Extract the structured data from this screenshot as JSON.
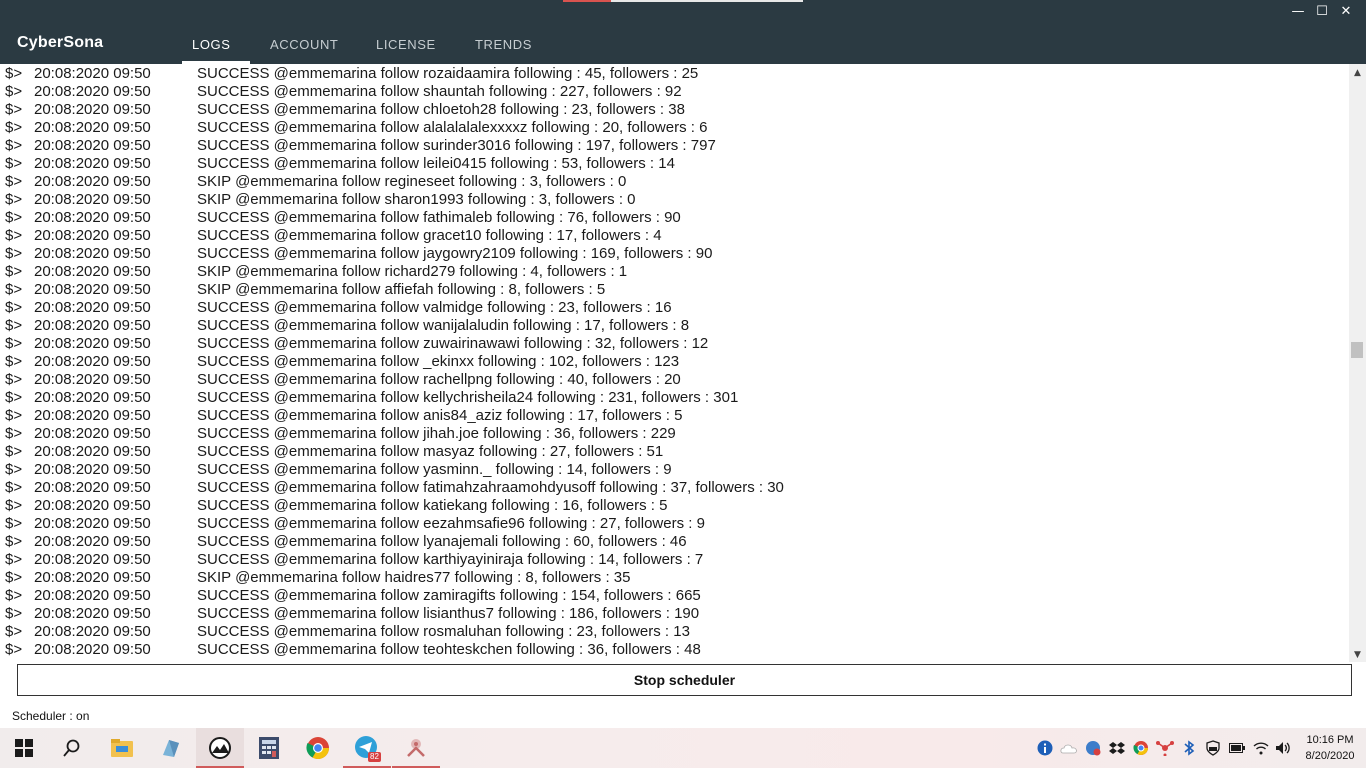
{
  "window": {
    "minimize": "—",
    "maximize": "☐",
    "close": "✕"
  },
  "app": {
    "title": "CyberSona"
  },
  "tabs": [
    {
      "label": "LOGS",
      "active": true
    },
    {
      "label": "ACCOUNT",
      "active": false
    },
    {
      "label": "LICENSE",
      "active": false
    },
    {
      "label": "TRENDS",
      "active": false
    }
  ],
  "logs": [
    {
      "prompt": "$>",
      "timestamp": "20:08:2020 09:50",
      "message": "SUCCESS @emmemarina follow rozaidaamira following : 45, followers : 25"
    },
    {
      "prompt": "$>",
      "timestamp": "20:08:2020 09:50",
      "message": "SUCCESS @emmemarina follow shauntah following : 227, followers : 92"
    },
    {
      "prompt": "$>",
      "timestamp": "20:08:2020 09:50",
      "message": "SUCCESS @emmemarina follow chloetoh28 following : 23, followers : 38"
    },
    {
      "prompt": "$>",
      "timestamp": "20:08:2020 09:50",
      "message": "SUCCESS @emmemarina follow alalalalalexxxxz following : 20, followers : 6"
    },
    {
      "prompt": "$>",
      "timestamp": "20:08:2020 09:50",
      "message": "SUCCESS @emmemarina follow surinder3016 following : 197, followers : 797"
    },
    {
      "prompt": "$>",
      "timestamp": "20:08:2020 09:50",
      "message": "SUCCESS @emmemarina follow leilei0415 following : 53, followers : 14"
    },
    {
      "prompt": "$>",
      "timestamp": "20:08:2020 09:50",
      "message": "SKIP @emmemarina follow regineseet following : 3, followers : 0"
    },
    {
      "prompt": "$>",
      "timestamp": "20:08:2020 09:50",
      "message": "SKIP @emmemarina follow sharon1993 following : 3, followers : 0"
    },
    {
      "prompt": "$>",
      "timestamp": "20:08:2020 09:50",
      "message": "SUCCESS @emmemarina follow fathimaleb following : 76, followers : 90"
    },
    {
      "prompt": "$>",
      "timestamp": "20:08:2020 09:50",
      "message": "SUCCESS @emmemarina follow gracet10 following : 17, followers : 4"
    },
    {
      "prompt": "$>",
      "timestamp": "20:08:2020 09:50",
      "message": "SUCCESS @emmemarina follow jaygowry2109 following : 169, followers : 90"
    },
    {
      "prompt": "$>",
      "timestamp": "20:08:2020 09:50",
      "message": "SKIP @emmemarina follow richard279 following : 4, followers : 1"
    },
    {
      "prompt": "$>",
      "timestamp": "20:08:2020 09:50",
      "message": "SKIP @emmemarina follow affiefah following : 8, followers : 5"
    },
    {
      "prompt": "$>",
      "timestamp": "20:08:2020 09:50",
      "message": "SUCCESS @emmemarina follow valmidge following : 23, followers : 16"
    },
    {
      "prompt": "$>",
      "timestamp": "20:08:2020 09:50",
      "message": "SUCCESS @emmemarina follow wanijalaludin following : 17, followers : 8"
    },
    {
      "prompt": "$>",
      "timestamp": "20:08:2020 09:50",
      "message": "SUCCESS @emmemarina follow zuwairinawawi following : 32, followers : 12"
    },
    {
      "prompt": "$>",
      "timestamp": "20:08:2020 09:50",
      "message": "SUCCESS @emmemarina follow _ekinxx following : 102, followers : 123"
    },
    {
      "prompt": "$>",
      "timestamp": "20:08:2020 09:50",
      "message": "SUCCESS @emmemarina follow rachellpng following : 40, followers : 20"
    },
    {
      "prompt": "$>",
      "timestamp": "20:08:2020 09:50",
      "message": "SUCCESS @emmemarina follow kellychrisheila24 following : 231, followers : 301"
    },
    {
      "prompt": "$>",
      "timestamp": "20:08:2020 09:50",
      "message": "SUCCESS @emmemarina follow anis84_aziz following : 17, followers : 5"
    },
    {
      "prompt": "$>",
      "timestamp": "20:08:2020 09:50",
      "message": "SUCCESS @emmemarina follow jihah.joe following : 36, followers : 229"
    },
    {
      "prompt": "$>",
      "timestamp": "20:08:2020 09:50",
      "message": "SUCCESS @emmemarina follow masyaz following : 27, followers : 51"
    },
    {
      "prompt": "$>",
      "timestamp": "20:08:2020 09:50",
      "message": "SUCCESS @emmemarina follow yasminn._ following : 14, followers : 9"
    },
    {
      "prompt": "$>",
      "timestamp": "20:08:2020 09:50",
      "message": "SUCCESS @emmemarina follow fatimahzahraamohdyusoff following : 37, followers : 30"
    },
    {
      "prompt": "$>",
      "timestamp": "20:08:2020 09:50",
      "message": "SUCCESS @emmemarina follow katiekang following : 16, followers : 5"
    },
    {
      "prompt": "$>",
      "timestamp": "20:08:2020 09:50",
      "message": "SUCCESS @emmemarina follow eezahmsafie96 following : 27, followers : 9"
    },
    {
      "prompt": "$>",
      "timestamp": "20:08:2020 09:50",
      "message": "SUCCESS @emmemarina follow lyanajemali following : 60, followers : 46"
    },
    {
      "prompt": "$>",
      "timestamp": "20:08:2020 09:50",
      "message": "SUCCESS @emmemarina follow karthiyayiniraja following : 14, followers : 7"
    },
    {
      "prompt": "$>",
      "timestamp": "20:08:2020 09:50",
      "message": "SKIP @emmemarina follow haidres77 following : 8, followers : 35"
    },
    {
      "prompt": "$>",
      "timestamp": "20:08:2020 09:50",
      "message": "SUCCESS @emmemarina follow zamiragifts following : 154, followers : 665"
    },
    {
      "prompt": "$>",
      "timestamp": "20:08:2020 09:50",
      "message": "SUCCESS @emmemarina follow lisianthus7 following : 186, followers : 190"
    },
    {
      "prompt": "$>",
      "timestamp": "20:08:2020 09:50",
      "message": "SUCCESS @emmemarina follow rosmaluhan following : 23, followers : 13"
    },
    {
      "prompt": "$>",
      "timestamp": "20:08:2020 09:50",
      "message": "SUCCESS @emmemarina follow teohteskchen following : 36, followers : 48"
    }
  ],
  "scroll": {
    "position_fraction": 0.47
  },
  "actions": {
    "stop_label": "Stop scheduler"
  },
  "status": {
    "scheduler_text": "Scheduler : on"
  },
  "taskbar": {
    "apps": [
      {
        "name": "start-icon"
      },
      {
        "name": "search-icon"
      },
      {
        "name": "file-explorer-icon"
      },
      {
        "name": "edge-icon"
      },
      {
        "name": "cybersona-app-icon",
        "active": true
      },
      {
        "name": "calculator-icon"
      },
      {
        "name": "chrome-icon"
      },
      {
        "name": "telegram-icon",
        "badge": "82"
      },
      {
        "name": "tool-icon"
      }
    ],
    "tray": [
      {
        "name": "info-icon"
      },
      {
        "name": "onedrive-icon"
      },
      {
        "name": "security-icon"
      },
      {
        "name": "dropbox-icon"
      },
      {
        "name": "chrome-tray-icon"
      },
      {
        "name": "network-share-icon"
      },
      {
        "name": "bluetooth-icon"
      },
      {
        "name": "defender-icon"
      },
      {
        "name": "battery-icon"
      },
      {
        "name": "wifi-icon"
      },
      {
        "name": "volume-icon"
      }
    ],
    "clock": {
      "time": "10:16 PM",
      "date": "8/20/2020"
    }
  }
}
